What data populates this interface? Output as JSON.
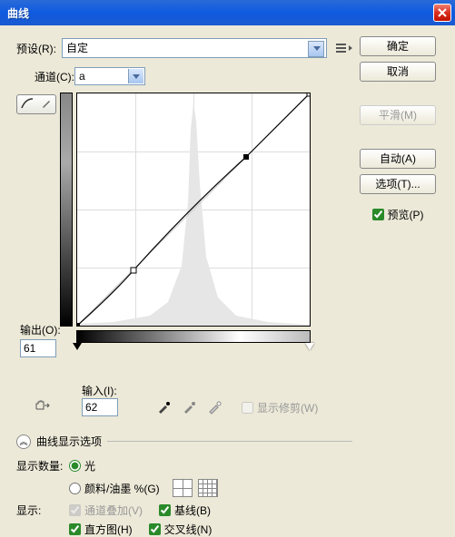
{
  "title": "曲线",
  "preset": {
    "label": "预设(R):",
    "value": "自定"
  },
  "buttons": {
    "ok": "确定",
    "cancel": "取消",
    "smooth": "平滑(M)",
    "auto": "自动(A)",
    "options": "选项(T)..."
  },
  "preview": {
    "label": "预览(P)"
  },
  "channel": {
    "label": "通道(C):",
    "value": "a"
  },
  "output": {
    "label": "输出(O):",
    "value": "61"
  },
  "input": {
    "label": "输入(I):",
    "value": "62"
  },
  "showClip": "显示修剪(W)",
  "section": "曲线显示选项",
  "amount": {
    "label": "显示数量:",
    "light": "光",
    "pigment": "颜料/油墨 %(G)"
  },
  "show": {
    "label": "显示:",
    "overlay": "通道叠加(V)",
    "baseline": "基线(B)",
    "histogram": "直方图(H)",
    "intersect": "交叉线(N)"
  },
  "chart_data": {
    "type": "line",
    "title": "Curves adjustment — channel a",
    "xlabel": "Input",
    "ylabel": "Output",
    "xlim": [
      0,
      255
    ],
    "ylim": [
      0,
      255
    ],
    "series": [
      {
        "name": "curve",
        "x": [
          0,
          62,
          186,
          255
        ],
        "y": [
          0,
          61,
          186,
          255
        ]
      }
    ],
    "selected_point": {
      "x": 62,
      "y": 61
    },
    "grid": true
  }
}
